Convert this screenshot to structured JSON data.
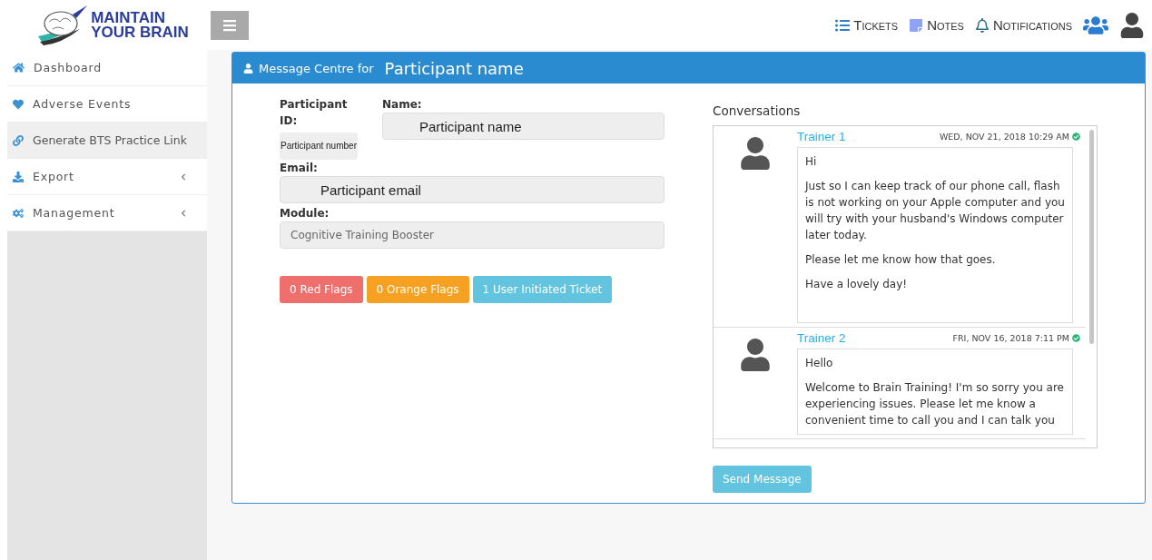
{
  "brand": {
    "line_1": "MAINTAIN",
    "line_2": "YOUR BRAIN"
  },
  "topnav": [
    {
      "label": "Tickets",
      "kind": "list"
    },
    {
      "label": "Notes",
      "kind": "note"
    },
    {
      "label": "Notifications",
      "kind": "bell"
    }
  ],
  "sidebar": {
    "items": [
      {
        "label": "Dashboard",
        "kind": "home",
        "selected": false,
        "expandable": false
      },
      {
        "label": "Adverse Events",
        "kind": "heart",
        "selected": false,
        "expandable": false
      },
      {
        "label": "Generate BTS Practice Link",
        "kind": "link",
        "selected": true,
        "expandable": false
      },
      {
        "label": "Export",
        "kind": "download",
        "selected": false,
        "expandable": true
      },
      {
        "label": "Management",
        "kind": "cogs",
        "selected": false,
        "expandable": true
      }
    ]
  },
  "panel": {
    "title": "Message Centre for",
    "participant": "Participant name"
  },
  "form": {
    "id_label": "Participant ID:",
    "id_value": "Participant number",
    "name_label": "Name:",
    "name_value": "Participant name",
    "email_label": "Email:",
    "email_value": "Participant email",
    "module_label": "Module:",
    "module_value": "Cognitive Training Booster"
  },
  "flags": [
    {
      "label": "0 Red Flags",
      "color": "#ef6f6c"
    },
    {
      "label": "0 Orange Flags",
      "color": "#f7a122"
    },
    {
      "label": "1 User Initiated Ticket",
      "color": "#62c4de"
    }
  ],
  "conversations": {
    "title": "Conversations",
    "messages": [
      {
        "author": "Trainer 1",
        "time": "WED, NOV 21, 2018 10:29 AM",
        "paragraphs": [
          "Hi",
          "Just so I can keep track of our phone call, flash is not working on your Apple computer and you will try with your husband's Windows computer later today.",
          "Please let me know how that goes.",
          "Have a lovely day!"
        ]
      },
      {
        "author": "Trainer 2",
        "time": "FRI, NOV 16, 2018 7:11 PM",
        "paragraphs": [
          "Hello",
          "Welcome to Brain Training! I'm so sorry you are experiencing issues.  Please let me know a convenient time to call you  and I can talk you"
        ]
      }
    ]
  },
  "send_button": "Send Message"
}
